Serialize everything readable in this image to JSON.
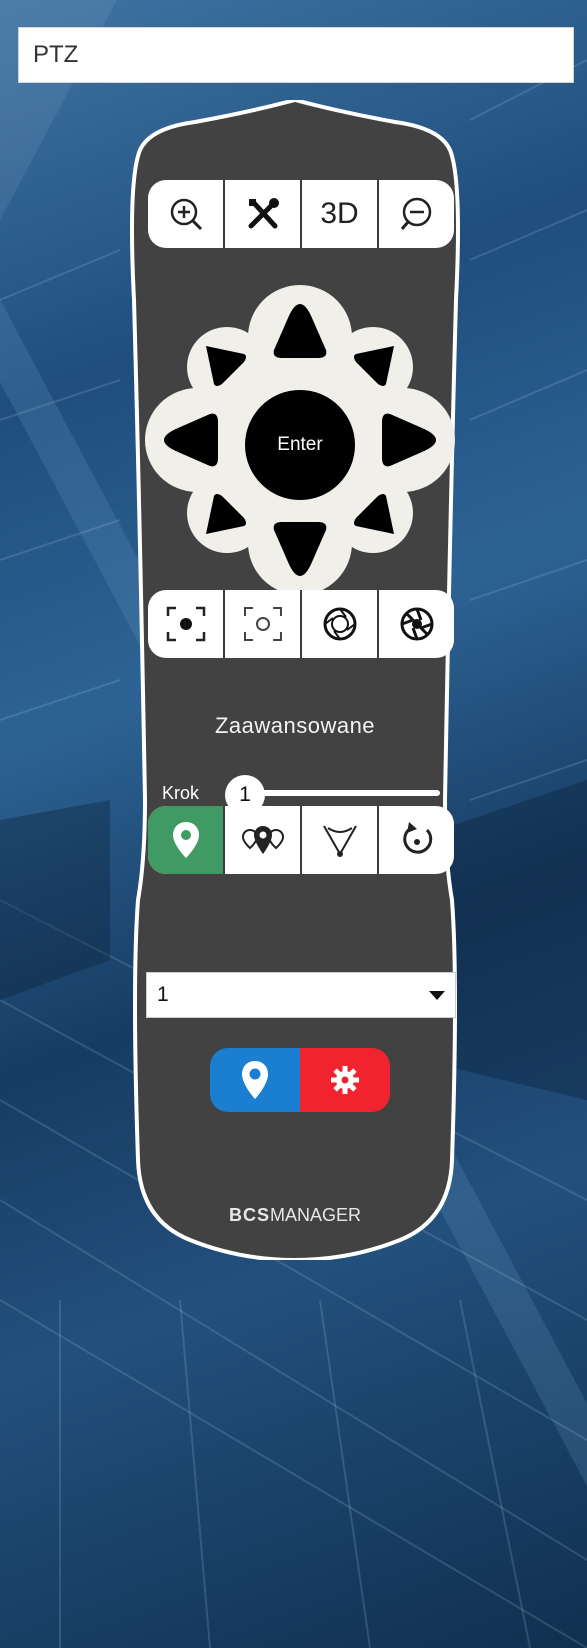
{
  "panel": {
    "title": "PTZ"
  },
  "top_controls": [
    {
      "name": "zoom-in",
      "icon": "zoom-in-icon"
    },
    {
      "name": "tools",
      "icon": "tools-icon"
    },
    {
      "name": "3d",
      "label": "3D"
    },
    {
      "name": "zoom-out",
      "icon": "zoom-out-icon"
    }
  ],
  "dpad": {
    "enter_label": "Enter"
  },
  "focus_iris_controls": [
    {
      "name": "focus-near",
      "icon": "focus-near-icon"
    },
    {
      "name": "focus-far",
      "icon": "focus-far-icon"
    },
    {
      "name": "iris-open",
      "icon": "iris-open-icon"
    },
    {
      "name": "iris-close",
      "icon": "iris-close-icon"
    }
  ],
  "advanced": {
    "label": "Zaawansowane",
    "step_label": "Krok",
    "step_value": "1"
  },
  "mode_controls": [
    {
      "name": "preset",
      "icon": "location-pin-icon",
      "active": true
    },
    {
      "name": "tour",
      "icon": "multi-pin-icon",
      "active": false
    },
    {
      "name": "scan",
      "icon": "scan-line-icon",
      "active": false
    },
    {
      "name": "rotate",
      "icon": "rotate-icon",
      "active": false
    }
  ],
  "preset_select": {
    "value": "1"
  },
  "actions": [
    {
      "name": "go-to-preset",
      "icon": "location-pin-icon",
      "color": "#1a7fd0"
    },
    {
      "name": "preset-settings",
      "icon": "gear-icon",
      "color": "#f0232f"
    }
  ],
  "brand": {
    "bold": "BCS",
    "rest": "MANAGER"
  },
  "colors": {
    "remote_body": "#424242",
    "active_green": "#3f9a63",
    "accent_blue": "#1a7fd0",
    "accent_red": "#f0232f"
  }
}
